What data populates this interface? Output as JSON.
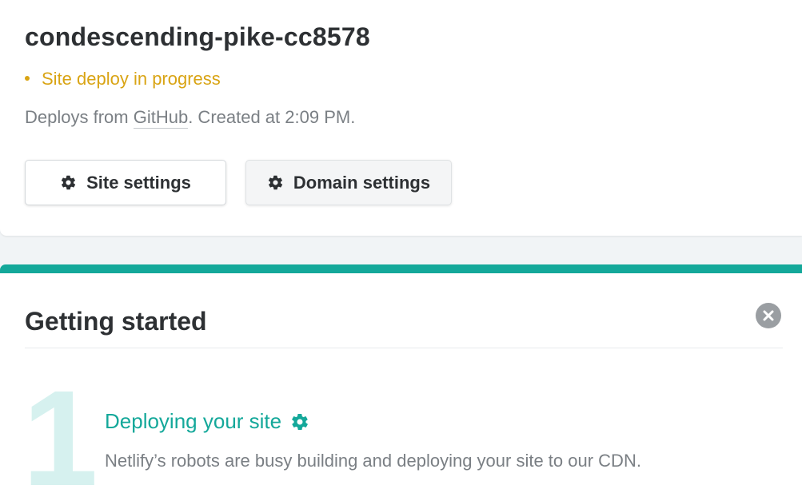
{
  "site": {
    "name": "condescending-pike-cc8578",
    "status": "Site deploy in progress",
    "meta_prefix": "Deploys from ",
    "meta_provider": "GitHub",
    "meta_suffix": ". Created at 2:09 PM.",
    "status_color": "#d9a414"
  },
  "buttons": {
    "site_settings": "Site settings",
    "domain_settings": "Domain settings"
  },
  "getting_started": {
    "title": "Getting started",
    "accent_color": "#14a89a",
    "step": {
      "number": "1",
      "title": "Deploying your site",
      "description": "Netlify’s robots are busy building and deploying your site to our CDN."
    }
  },
  "icons": {
    "gear": "gear-icon",
    "close": "close-icon",
    "status_dot": "status-dot-icon"
  }
}
